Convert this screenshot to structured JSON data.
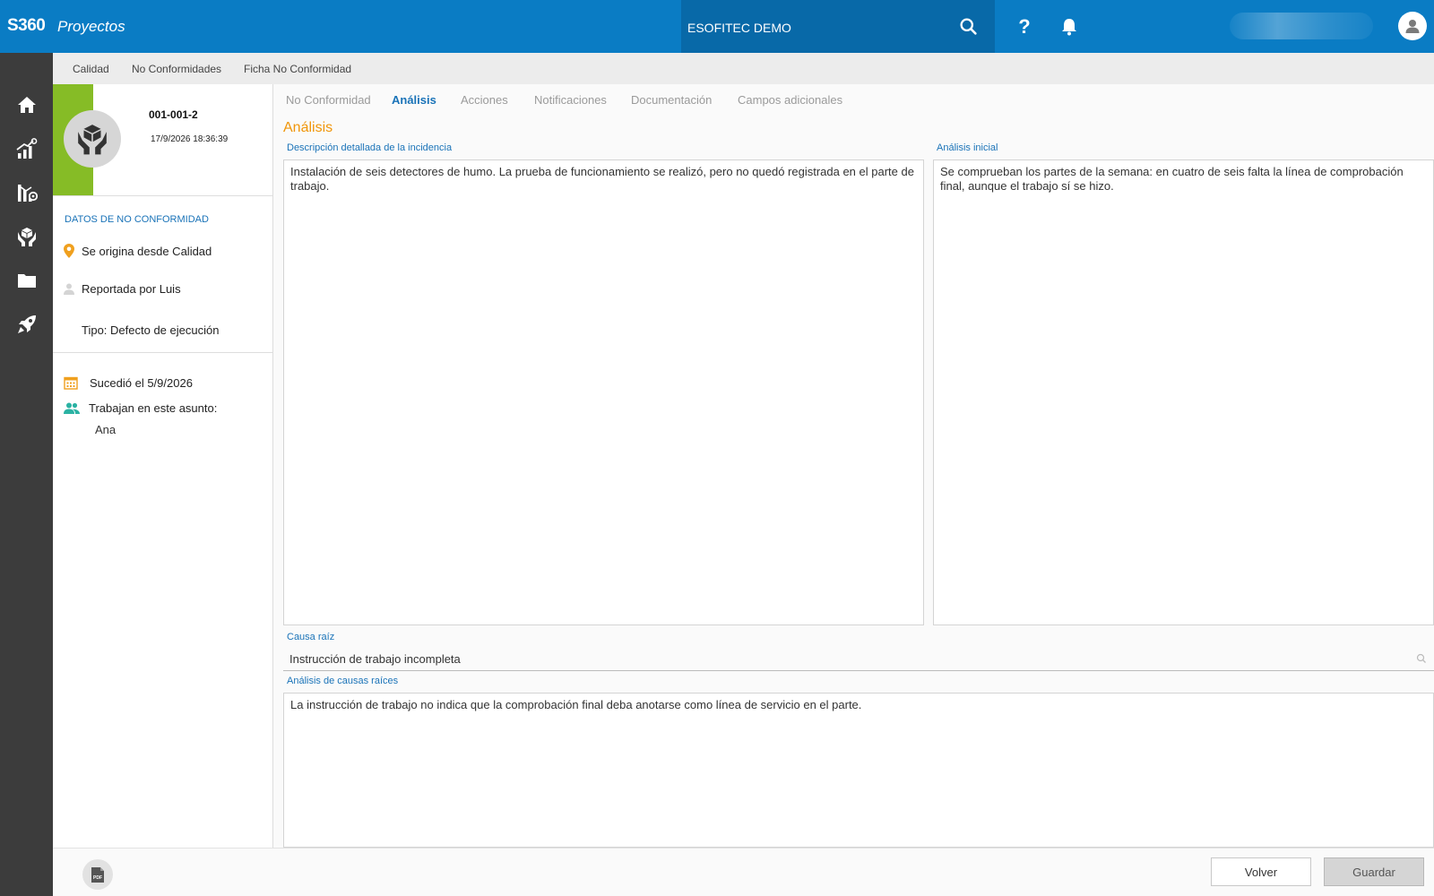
{
  "header": {
    "logo": "S360",
    "app_name": "Proyectos",
    "company": "ESOFITEC DEMO",
    "help_label": "?"
  },
  "breadcrumb": [
    "Calidad",
    "No Conformidades",
    "Ficha No Conformidad"
  ],
  "record": {
    "code": "001-001-2",
    "date": "17/9/2026 18:36:39",
    "accent_color": "#86bc26"
  },
  "details": {
    "section_title": "DATOS DE NO CONFORMIDAD",
    "origin": "Se origina desde Calidad",
    "reported_by": "Reportada por Luis",
    "type": "Tipo: Defecto de ejecución",
    "occurred": "Sucedió el 5/9/2026",
    "workers_label": "Trabajan en este asunto:",
    "workers": "Ana"
  },
  "tabs": [
    "No Conformidad",
    "Análisis",
    "Acciones",
    "Notificaciones",
    "Documentación",
    "Campos adicionales"
  ],
  "active_tab": "Análisis",
  "analysis": {
    "heading": "Análisis",
    "description_label": "Descripción detallada de la incidencia",
    "description_value": "Instalación de seis detectores de humo. La prueba de funcionamiento se realizó, pero no quedó registrada en el parte de trabajo.",
    "initial_label": "Análisis inicial",
    "initial_value": "Se comprueban los partes de la semana: en cuatro de seis falta la línea de comprobación final, aunque el trabajo sí se hizo.",
    "root_cause_label": "Causa raíz",
    "root_cause_value": "Instrucción de trabajo incompleta",
    "root_cause_analysis_label": "Análisis de causas raíces",
    "root_cause_analysis_value": "La instrucción de trabajo no indica que la comprobación final deba anotarse como línea de servicio en el parte."
  },
  "footer": {
    "back_label": "Volver",
    "save_label": "Guardar",
    "pdf_label": "PDF"
  },
  "icons": {
    "nav": [
      "home-icon",
      "stats-icon",
      "chart-settings-icon",
      "quality-hands-icon",
      "folder-icon",
      "rocket-icon"
    ],
    "origin": "location-pin-icon",
    "reporter": "user-icon",
    "occurred": "calendar-icon",
    "workers": "users-icon"
  },
  "colors": {
    "primary": "#0a7cc4",
    "accent_orange": "#f0960a",
    "link_blue": "#1a73b8",
    "nav_dark": "#3c3c3c"
  }
}
